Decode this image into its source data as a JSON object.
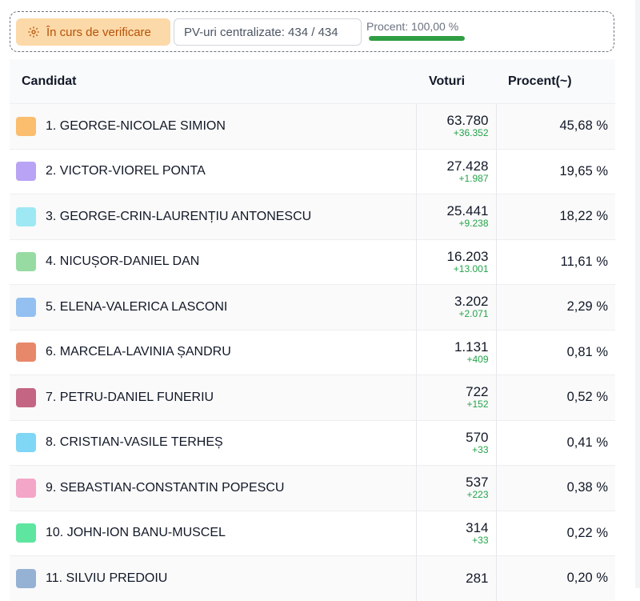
{
  "status": {
    "verify_label": "În curs de verificare",
    "pv_label": "PV-uri centralizate: 434 / 434",
    "percent_label": "Procent: 100,00 %",
    "percent_value": 100
  },
  "table": {
    "headers": {
      "candidate": "Candidat",
      "votes": "Voturi",
      "percent": "Procent(~)"
    },
    "rows": [
      {
        "name": "1. GEORGE-NICOLAE SIMION",
        "votes": "63.780",
        "delta": "+36.352",
        "percent": "45,68 %",
        "color": "#fbbd6e"
      },
      {
        "name": "2. VICTOR-VIOREL PONTA",
        "votes": "27.428",
        "delta": "+1.987",
        "percent": "19,65 %",
        "color": "#b9a3f4"
      },
      {
        "name": "3. GEORGE-CRIN-LAURENȚIU ANTONESCU",
        "votes": "25.441",
        "delta": "+9.238",
        "percent": "18,22 %",
        "color": "#9ee8f4"
      },
      {
        "name": "4. NICUȘOR-DANIEL DAN",
        "votes": "16.203",
        "delta": "+13.001",
        "percent": "11,61 %",
        "color": "#97dba2"
      },
      {
        "name": "5. ELENA-VALERICA LASCONI",
        "votes": "3.202",
        "delta": "+2.071",
        "percent": "2,29 %",
        "color": "#93c0f0"
      },
      {
        "name": "6. MARCELA-LAVINIA ȘANDRU",
        "votes": "1.131",
        "delta": "+409",
        "percent": "0,81 %",
        "color": "#e8886a"
      },
      {
        "name": "7. PETRU-DANIEL FUNERIU",
        "votes": "722",
        "delta": "+152",
        "percent": "0,52 %",
        "color": "#c46583"
      },
      {
        "name": "8. CRISTIAN-VASILE TERHEȘ",
        "votes": "570",
        "delta": "+33",
        "percent": "0,41 %",
        "color": "#7fd6f5"
      },
      {
        "name": "9. SEBASTIAN-CONSTANTIN POPESCU",
        "votes": "537",
        "delta": "+223",
        "percent": "0,38 %",
        "color": "#f3a6c8"
      },
      {
        "name": "10. JOHN-ION BANU-MUSCEL",
        "votes": "314",
        "delta": "+33",
        "percent": "0,22 %",
        "color": "#5ee6a0"
      },
      {
        "name": "11. SILVIU PREDOIU",
        "votes": "281",
        "delta": "",
        "percent": "0,20 %",
        "color": "#95b2d4"
      }
    ]
  }
}
